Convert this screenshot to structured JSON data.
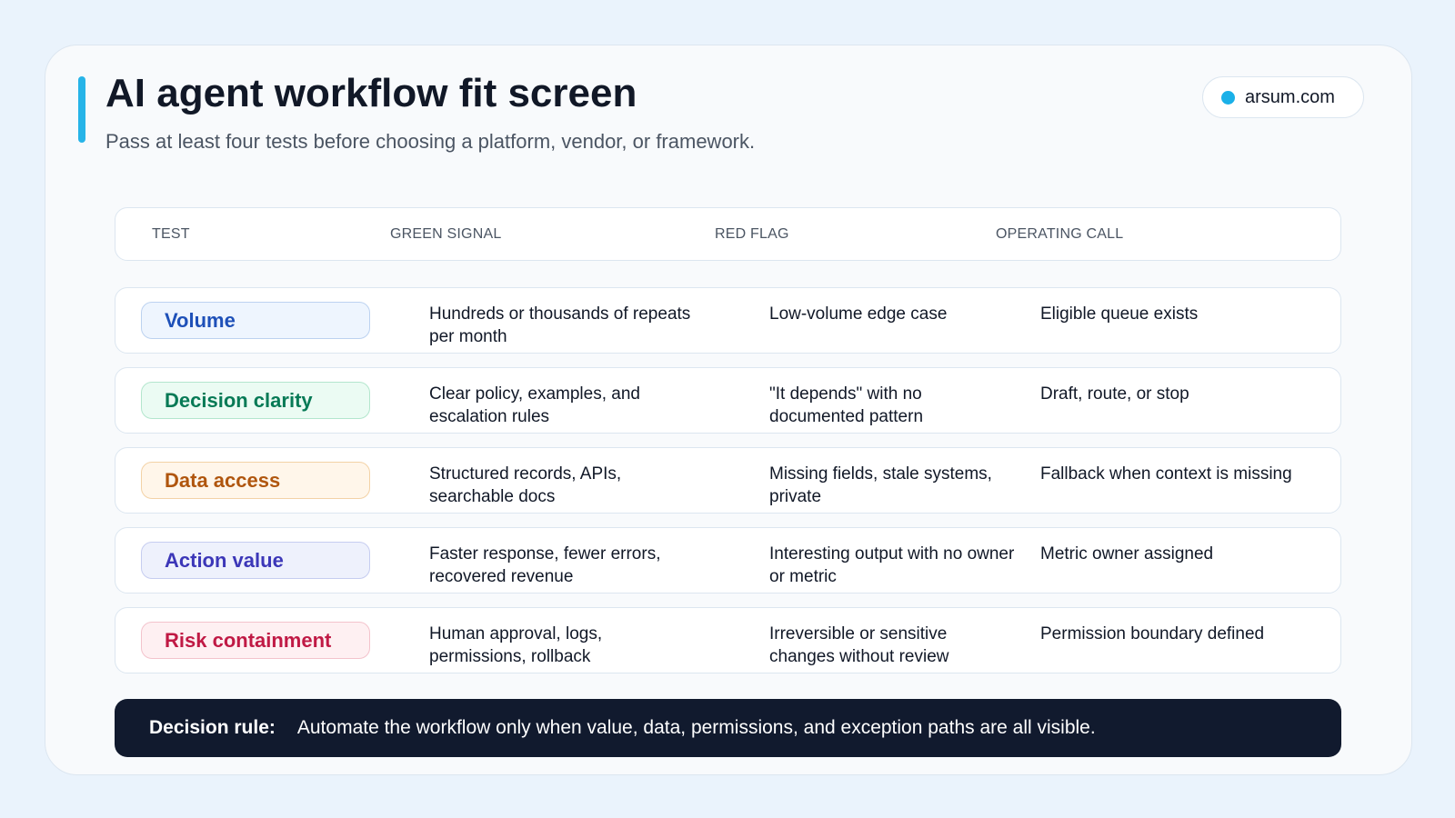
{
  "header": {
    "title": "AI agent workflow fit screen",
    "subtitle": "Pass at least four tests before choosing a platform, vendor, or framework."
  },
  "brand": {
    "label": "arsum.com",
    "dot_color": "#1ab0e8"
  },
  "table": {
    "columns": [
      "TEST",
      "GREEN SIGNAL",
      "RED FLAG",
      "OPERATING CALL"
    ],
    "rows": [
      {
        "test": "Volume",
        "green_signal": "Hundreds or thousands of repeats per month",
        "red_flag": "Low-volume edge case",
        "operating_call": "Eligible queue exists",
        "color": "#1e50b8",
        "bg": "#eef5fe",
        "border": "#bcd2f0"
      },
      {
        "test": "Decision clarity",
        "green_signal": "Clear policy, examples, and escalation rules",
        "red_flag": "\"It depends\" with no documented pattern",
        "operating_call": "Draft, route, or stop",
        "color": "#077a56",
        "bg": "#ebfbf3",
        "border": "#b3e6cd"
      },
      {
        "test": "Data access",
        "green_signal": "Structured records, APIs, searchable docs",
        "red_flag": "Missing fields, stale systems, private",
        "operating_call": "Fallback when context is missing",
        "color": "#b0560e",
        "bg": "#fff6ea",
        "border": "#f3d2a6"
      },
      {
        "test": "Action value",
        "green_signal": "Faster response, fewer errors, recovered revenue",
        "red_flag": "Interesting output with no owner or metric",
        "operating_call": "Metric owner assigned",
        "color": "#3c37b8",
        "bg": "#eef1fc",
        "border": "#c6cdf0"
      },
      {
        "test": "Risk containment",
        "green_signal": "Human approval, logs, permissions, rollback",
        "red_flag": "Irreversible or sensitive changes without review",
        "operating_call": "Permission boundary defined",
        "color": "#c01a45",
        "bg": "#fef0f2",
        "border": "#f3c3cc"
      }
    ]
  },
  "decision_rule": {
    "label": "Decision rule:",
    "text": "Automate the workflow only when value, data, permissions, and exception paths are all visible."
  },
  "colors": {
    "background": "#eaf3fc",
    "accent": "#27b4e8",
    "rule_bar": "#111a2e"
  }
}
